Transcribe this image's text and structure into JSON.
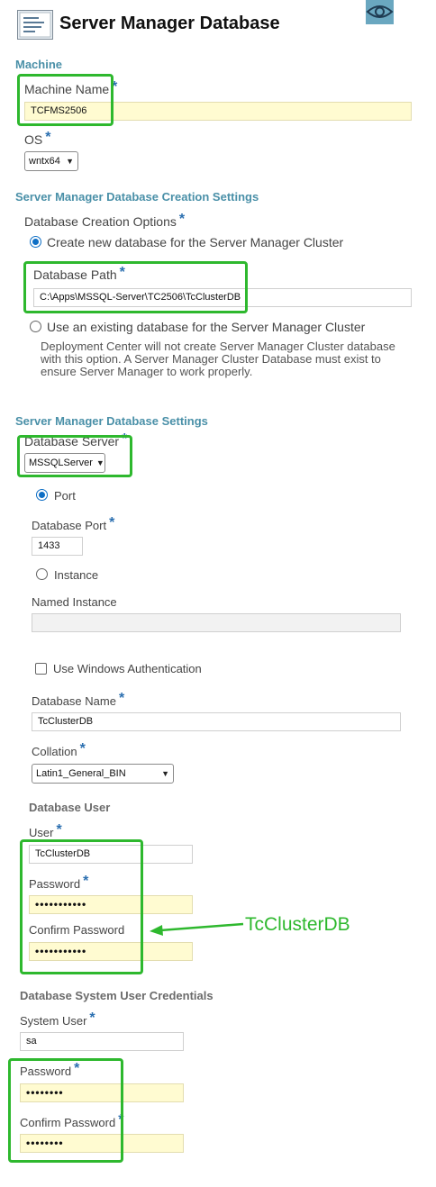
{
  "header": {
    "title": "Server Manager Database"
  },
  "machine": {
    "section_title": "Machine",
    "machine_name_label": "Machine Name",
    "machine_name_value": "TCFMS2506",
    "os_label": "OS",
    "os_value": "wntx64"
  },
  "creation": {
    "section_title": "Server Manager Database Creation Settings",
    "options_label": "Database Creation Options",
    "option_new": "Create new database for the Server Manager Cluster",
    "db_path_label": "Database Path",
    "db_path_value": "C:\\Apps\\MSSQL-Server\\TC2506\\TcClusterDB",
    "option_existing": "Use an existing database for the Server Manager Cluster",
    "existing_help": "Deployment Center will not create Server Manager Cluster database with this option. A Server Manager Cluster Database must exist to ensure Server Manager to work properly."
  },
  "settings": {
    "section_title": "Server Manager Database Settings",
    "db_server_label": "Database Server",
    "db_server_value": "MSSQLServer",
    "port_radio_label": "Port",
    "db_port_label": "Database Port",
    "db_port_value": "1433",
    "instance_radio_label": "Instance",
    "named_instance_label": "Named Instance",
    "named_instance_value": "",
    "windows_auth_label": "Use Windows Authentication",
    "db_name_label": "Database Name",
    "db_name_value": "TcClusterDB",
    "collation_label": "Collation",
    "collation_value": "Latin1_General_BIN"
  },
  "db_user": {
    "section_title": "Database User",
    "user_label": "User",
    "user_value": "TcClusterDB",
    "password_label": "Password",
    "password_value": "•••••••••••",
    "confirm_label": "Confirm Password",
    "confirm_value": "•••••••••••"
  },
  "system_user": {
    "section_title": "Database System User Credentials",
    "system_user_label": "System User",
    "system_user_value": "sa",
    "password_label": "Password",
    "password_value": "••••••••",
    "confirm_label": "Confirm Password",
    "confirm_value": "••••••••"
  },
  "annotation": {
    "text": "TcClusterDB"
  },
  "colors": {
    "highlight": "#2eb82e",
    "section_title": "#4a90a8",
    "required_star": "#2b6fb0",
    "yellow_input": "#fffbd1"
  },
  "icons": {
    "page_icon": "document-lines-icon",
    "view_icon": "eye-icon"
  }
}
